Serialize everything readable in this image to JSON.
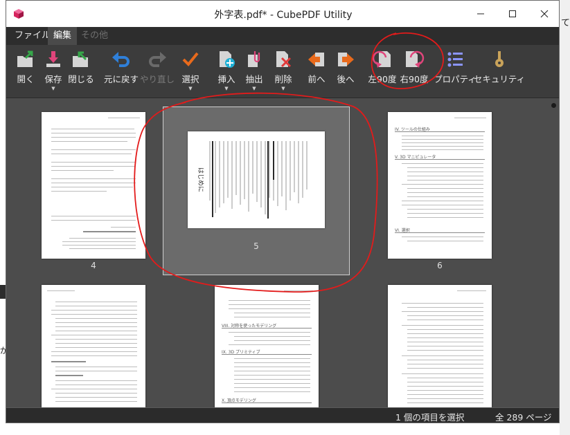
{
  "window": {
    "title": "外字表.pdf* - CubePDF Utility",
    "controls": [
      "minimize",
      "maximize",
      "close"
    ]
  },
  "menu": [
    {
      "label": "ファイル",
      "state": "normal"
    },
    {
      "label": "編集",
      "state": "active"
    },
    {
      "label": "その他",
      "state": "disabled"
    }
  ],
  "toolbar": [
    {
      "label": "開く",
      "icon": "open-folder-icon",
      "enabled": true,
      "dropdown": false
    },
    {
      "label": "保存",
      "icon": "save-arrow-icon",
      "enabled": true,
      "dropdown": true
    },
    {
      "label": "閉じる",
      "icon": "close-folder-icon",
      "enabled": true,
      "dropdown": false
    },
    {
      "label": "元に戻す",
      "icon": "undo-icon",
      "enabled": true,
      "dropdown": false
    },
    {
      "label": "やり直し",
      "icon": "redo-icon",
      "enabled": false,
      "dropdown": false
    },
    {
      "label": "選択",
      "icon": "checkmark-icon",
      "enabled": true,
      "dropdown": true
    },
    {
      "label": "挿入",
      "icon": "insert-page-icon",
      "enabled": true,
      "dropdown": true
    },
    {
      "label": "抽出",
      "icon": "extract-clip-icon",
      "enabled": true,
      "dropdown": true
    },
    {
      "label": "削除",
      "icon": "delete-page-icon",
      "enabled": true,
      "dropdown": true
    },
    {
      "label": "前へ",
      "icon": "move-previous-icon",
      "enabled": true,
      "dropdown": false
    },
    {
      "label": "後へ",
      "icon": "move-next-icon",
      "enabled": true,
      "dropdown": false
    },
    {
      "label": "左90度",
      "icon": "rotate-left-icon",
      "enabled": true,
      "dropdown": false
    },
    {
      "label": "右90度",
      "icon": "rotate-right-icon",
      "enabled": true,
      "dropdown": false
    },
    {
      "label": "プロパティ",
      "icon": "properties-list-icon",
      "enabled": true,
      "dropdown": false
    },
    {
      "label": "セキュリティ",
      "icon": "security-key-icon",
      "enabled": true,
      "dropdown": false
    }
  ],
  "pages": [
    {
      "number": "4",
      "selected": false
    },
    {
      "number": "5",
      "selected": true
    },
    {
      "number": "6",
      "selected": false
    },
    {
      "number": "",
      "selected": false
    },
    {
      "number": "",
      "selected": false
    },
    {
      "number": "",
      "selected": false
    }
  ],
  "thumbnail_text": {
    "p6_sections": [
      "IV. ツールの仕組み",
      "V. 3D マニピュレータ",
      "VI. 選択"
    ],
    "p8_sections": [
      "VIII. 対称を使ったモデリング",
      "IX. 3D プリミティブ",
      "X. 頂点モデリング"
    ],
    "p5_heading": "はじめに"
  },
  "status": {
    "selection": "1 個の項目を選択",
    "total": "全 289 ページ"
  },
  "background": {
    "right_fragment": "て",
    "left_fragment": "が"
  },
  "colors": {
    "window_bg": "#3f3f3f",
    "content_bg": "#4c4c4c",
    "selection_frame": "#6b6b6b",
    "annotation": "#e31b1b",
    "accent_green": "#36a84a",
    "accent_pink": "#e0457b",
    "accent_orange": "#e86a1c"
  }
}
